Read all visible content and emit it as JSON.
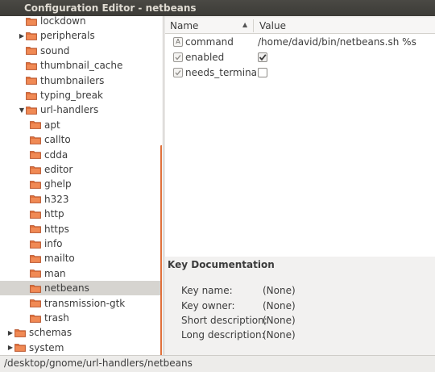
{
  "window": {
    "title": "Configuration Editor - netbeans"
  },
  "tree": {
    "items": [
      {
        "label": "lockdown",
        "level": 1,
        "expander": "none",
        "selected": false
      },
      {
        "label": "peripherals",
        "level": 1,
        "expander": "collapsed",
        "selected": false
      },
      {
        "label": "sound",
        "level": 1,
        "expander": "none",
        "selected": false
      },
      {
        "label": "thumbnail_cache",
        "level": 1,
        "expander": "none",
        "selected": false
      },
      {
        "label": "thumbnailers",
        "level": 1,
        "expander": "none",
        "selected": false
      },
      {
        "label": "typing_break",
        "level": 1,
        "expander": "none",
        "selected": false
      },
      {
        "label": "url-handlers",
        "level": 1,
        "expander": "expanded",
        "selected": false
      },
      {
        "label": "apt",
        "level": 2,
        "expander": "none",
        "selected": false
      },
      {
        "label": "callto",
        "level": 2,
        "expander": "none",
        "selected": false
      },
      {
        "label": "cdda",
        "level": 2,
        "expander": "none",
        "selected": false
      },
      {
        "label": "editor",
        "level": 2,
        "expander": "none",
        "selected": false
      },
      {
        "label": "ghelp",
        "level": 2,
        "expander": "none",
        "selected": false
      },
      {
        "label": "h323",
        "level": 2,
        "expander": "none",
        "selected": false
      },
      {
        "label": "http",
        "level": 2,
        "expander": "none",
        "selected": false
      },
      {
        "label": "https",
        "level": 2,
        "expander": "none",
        "selected": false
      },
      {
        "label": "info",
        "level": 2,
        "expander": "none",
        "selected": false
      },
      {
        "label": "mailto",
        "level": 2,
        "expander": "none",
        "selected": false
      },
      {
        "label": "man",
        "level": 2,
        "expander": "none",
        "selected": false
      },
      {
        "label": "netbeans",
        "level": 2,
        "expander": "none",
        "selected": true
      },
      {
        "label": "transmission-gtk",
        "level": 2,
        "expander": "none",
        "selected": false
      },
      {
        "label": "trash",
        "level": 2,
        "expander": "none",
        "selected": false
      },
      {
        "label": "schemas",
        "level": 0,
        "expander": "collapsed",
        "selected": false
      },
      {
        "label": "system",
        "level": 0,
        "expander": "collapsed",
        "selected": false
      }
    ]
  },
  "list": {
    "columns": {
      "name": "Name",
      "value": "Value"
    },
    "rows": [
      {
        "name": "command",
        "type_icon": "A",
        "value": "/home/david/bin/netbeans.sh %s"
      },
      {
        "name": "enabled",
        "type_icon": "check-icon",
        "checked": true
      },
      {
        "name": "needs_terminal",
        "type_icon": "check-icon",
        "checked": false
      }
    ]
  },
  "doc": {
    "title": "Key Documentation",
    "fields": [
      {
        "label": "Key name:",
        "value": "(None)"
      },
      {
        "label": "Key owner:",
        "value": "(None)"
      },
      {
        "label": "Short description:",
        "value": "(None)"
      },
      {
        "label": "Long description:",
        "value": "(None)"
      }
    ]
  },
  "status": {
    "path": "/desktop/gnome/url-handlers/netbeans"
  },
  "colors": {
    "folder": "#e0703b",
    "selection": "#d6d4d0",
    "titlebar": "#3c3b37"
  }
}
